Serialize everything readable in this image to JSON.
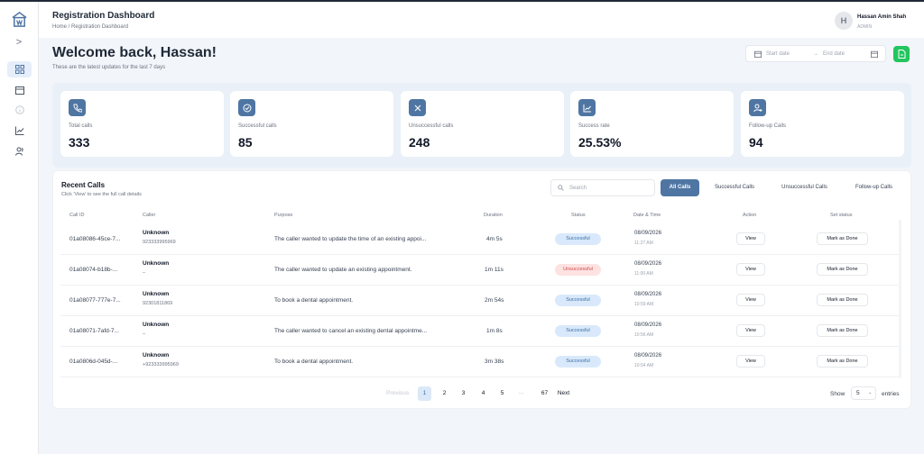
{
  "header": {
    "title": "Registration Dashboard",
    "breadcrumb": "Home / Registration Dashboard",
    "avatar_initial": "H",
    "user_name": "Hassan Amin Shah",
    "user_role": "ADMIN"
  },
  "welcome": {
    "title": "Welcome back, Hassan!",
    "subtitle": "These are the latest updates for the last 7 days"
  },
  "date_range": {
    "start_placeholder": "Start date",
    "arrow": "→",
    "end_placeholder": "End date"
  },
  "stats": [
    {
      "label": "Total calls",
      "value": "333",
      "icon": "phone-icon"
    },
    {
      "label": "Successful calls",
      "value": "85",
      "icon": "check-circle-icon"
    },
    {
      "label": "Unsuccessful calls",
      "value": "248",
      "icon": "x-icon"
    },
    {
      "label": "Success rate",
      "value": "25.53%",
      "icon": "chart-icon"
    },
    {
      "label": "Follow-up Calls",
      "value": "94",
      "icon": "user-follow-icon"
    }
  ],
  "recent": {
    "title": "Recent Calls",
    "subtitle": "Click 'View' to see the full call details",
    "search_placeholder": "Search",
    "filters": [
      "All Calls",
      "Successful Calls",
      "Unsuccessful Calls",
      "Follow-up Calls"
    ],
    "active_filter": "All Calls",
    "columns": [
      "Call ID",
      "Caller",
      "Purpose",
      "Duration",
      "Status",
      "Date & Time",
      "Action",
      "Set status"
    ],
    "rows": [
      {
        "id": "01a08086-45ce-7...",
        "caller": "Unknown",
        "phone": "923333995969",
        "purpose": "The caller wanted to update the time of an existing appoi...",
        "duration": "4m 5s",
        "status": "Successful",
        "date": "08/09/2026",
        "time": "11:27 AM",
        "action": "View",
        "set_status": "Mark as Done"
      },
      {
        "id": "01a08074-b18b-...",
        "caller": "Unknown",
        "phone": "–",
        "purpose": "The caller wanted to update an existing appointment.",
        "duration": "1m 11s",
        "status": "Unsuccessful",
        "date": "08/09/2026",
        "time": "11:00 AM",
        "action": "View",
        "set_status": "Mark as Done"
      },
      {
        "id": "01a08077-777e-7...",
        "caller": "Unknown",
        "phone": "92301811869",
        "purpose": "To book a dental appointment.",
        "duration": "2m 54s",
        "status": "Successful",
        "date": "08/09/2026",
        "time": "10:59 AM",
        "action": "View",
        "set_status": "Mark as Done"
      },
      {
        "id": "01a08071-7afd-7...",
        "caller": "Unknown",
        "phone": "–",
        "purpose": "The caller wanted to cancel an existing dental appointme...",
        "duration": "1m 8s",
        "status": "Successful",
        "date": "08/09/2026",
        "time": "10:56 AM",
        "action": "View",
        "set_status": "Mark as Done"
      },
      {
        "id": "01a0806d-045d-...",
        "caller": "Unknown",
        "phone": "+923333995969",
        "purpose": "To book a dental appointment.",
        "duration": "3m 38s",
        "status": "Successful",
        "date": "08/09/2026",
        "time": "10:54 AM",
        "action": "View",
        "set_status": "Mark as Done"
      }
    ]
  },
  "pagination": {
    "previous": "Previous",
    "pages": [
      "1",
      "2",
      "3",
      "4",
      "5"
    ],
    "ellipsis": "···",
    "last": "67",
    "next": "Next",
    "current": "1",
    "show_label": "Show",
    "page_size": "5",
    "entries_label": "entries"
  },
  "colors": {
    "accent": "#4f76a3",
    "success_bg": "#d9e9fb",
    "fail_bg": "#fde2e2",
    "export": "#22c55e"
  }
}
